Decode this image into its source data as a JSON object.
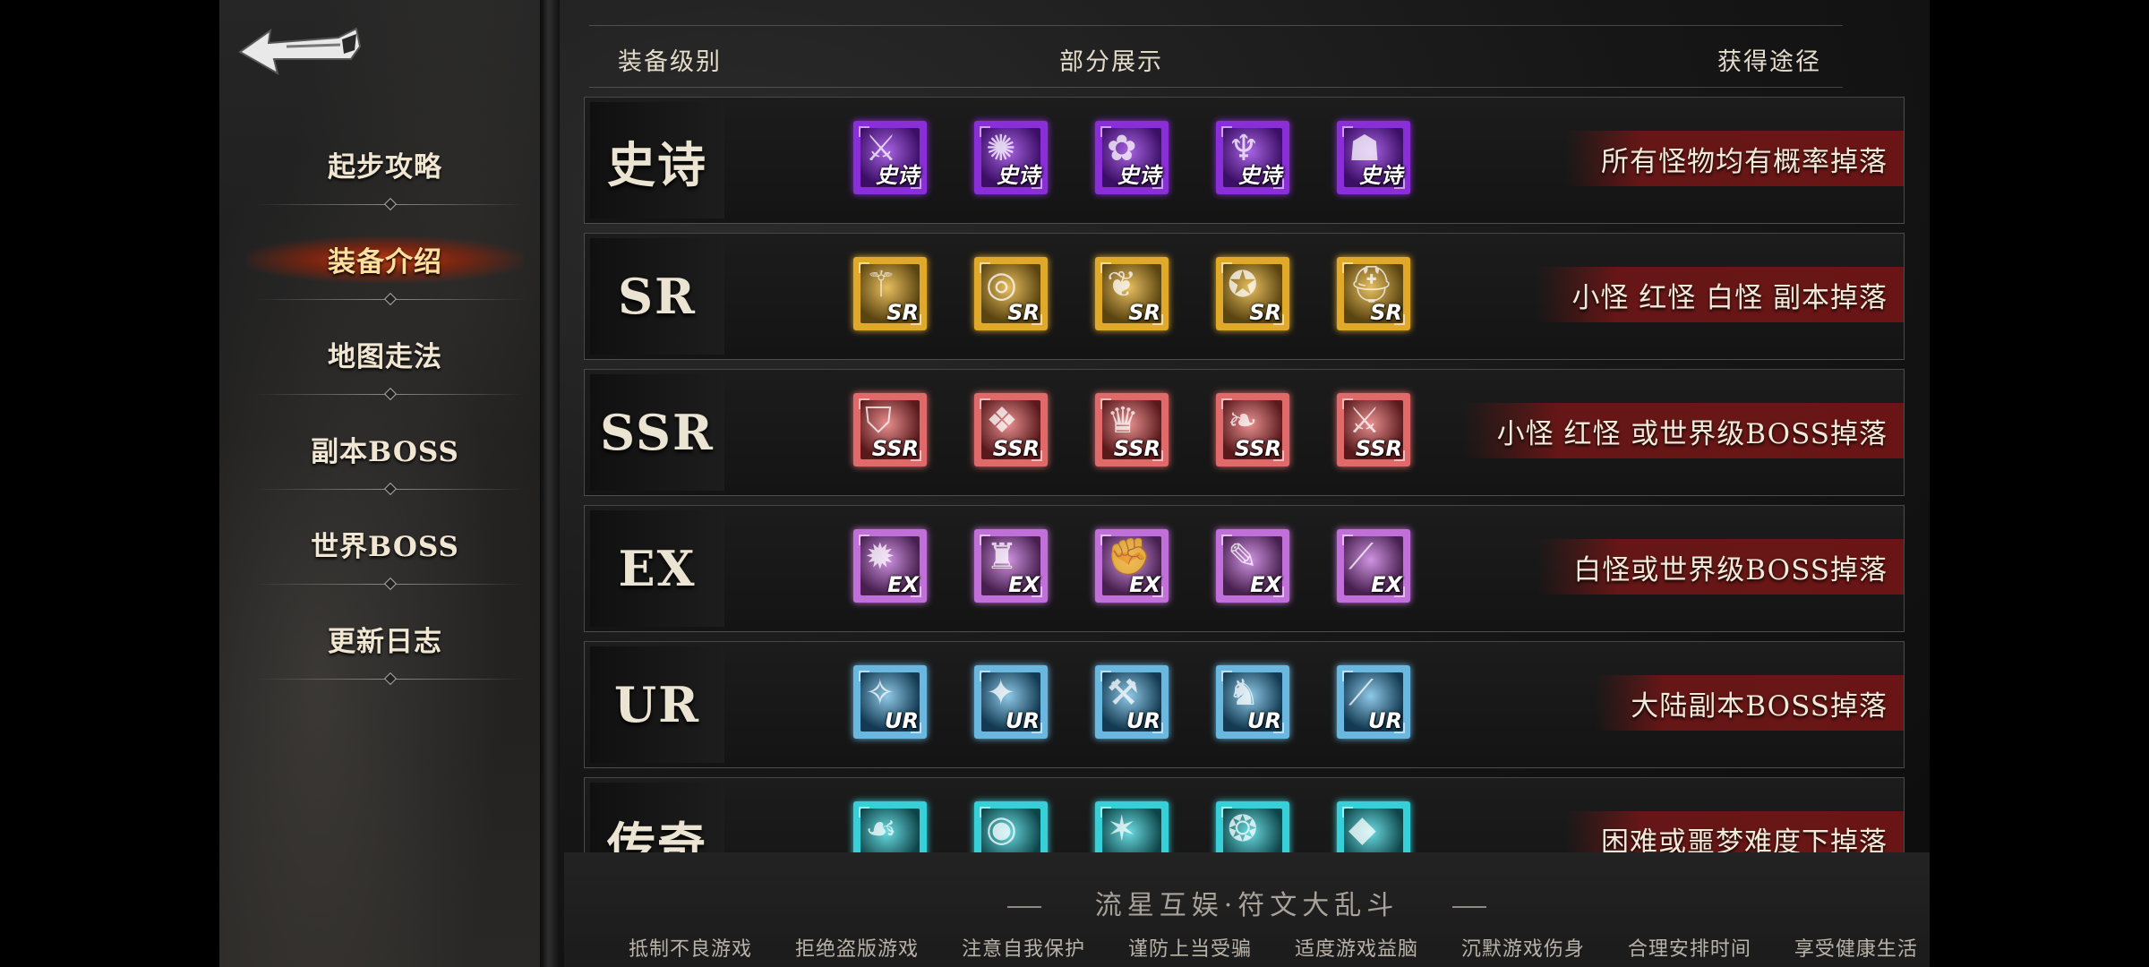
{
  "sidebar": {
    "items": [
      {
        "label": "起步攻略",
        "active": false
      },
      {
        "label": "装备介绍",
        "active": true
      },
      {
        "label": "地图走法",
        "active": false
      },
      {
        "label": "副本BOSS",
        "active": false
      },
      {
        "label": "世界BOSS",
        "active": false
      },
      {
        "label": "更新日志",
        "active": false
      }
    ]
  },
  "table": {
    "headers": {
      "level": "装备级别",
      "showcase": "部分展示",
      "source": "获得途径"
    },
    "rows": [
      {
        "level": "史诗",
        "badge": "史诗",
        "frame": "#8a2ed8",
        "fill": "#3c0f66",
        "source": "所有怪物均有概率掉落",
        "icons": [
          "sword-icon",
          "compass-icon",
          "flower-icon",
          "crab-icon",
          "mask-icon"
        ]
      },
      {
        "level": "SR",
        "badge": "SR",
        "frame": "#e0a92a",
        "fill": "#5a4410",
        "source": "小怪 红怪 白怪 副本掉落",
        "icons": [
          "staff-icon",
          "ring-icon",
          "scroll-icon",
          "amulet-icon",
          "helmet-icon"
        ]
      },
      {
        "level": "SSR",
        "badge": "SSR",
        "frame": "#e06a6a",
        "fill": "#5a1a1c",
        "source": "小怪 红怪 或世界级BOSS掉落",
        "icons": [
          "shield-icon",
          "armor-icon",
          "crown-icon",
          "wings-icon",
          "blade-icon"
        ]
      },
      {
        "level": "EX",
        "badge": "EX",
        "frame": "#c070d8",
        "fill": "#48204f",
        "source": "白怪或世界级BOSS掉落",
        "icons": [
          "bomb-icon",
          "helm-icon",
          "gauntlet-icon",
          "feather-icon",
          "spear-icon"
        ]
      },
      {
        "level": "UR",
        "badge": "UR",
        "frame": "#6ab8e0",
        "fill": "#133a52",
        "source": "大陆副本BOSS掉落",
        "icons": [
          "claw-icon",
          "star-icon",
          "mace-icon",
          "dragon-icon",
          "lance-icon"
        ]
      },
      {
        "level": "传奇",
        "badge": "",
        "frame": "#38d0d8",
        "fill": "#0d4448",
        "source": "困难或噩梦难度下掉落",
        "icons": [
          "cloak-icon",
          "orb-icon",
          "rune-icon",
          "seal-icon",
          "gem-icon"
        ]
      }
    ]
  },
  "footer": {
    "brand": "流星互娱·符文大乱斗",
    "notices": [
      "抵制不良游戏",
      "拒绝盗版游戏",
      "注意自我保护",
      "谨防上当受骗",
      "适度游戏益脑",
      "沉默游戏伤身",
      "合理安排时间",
      "享受健康生活"
    ]
  }
}
